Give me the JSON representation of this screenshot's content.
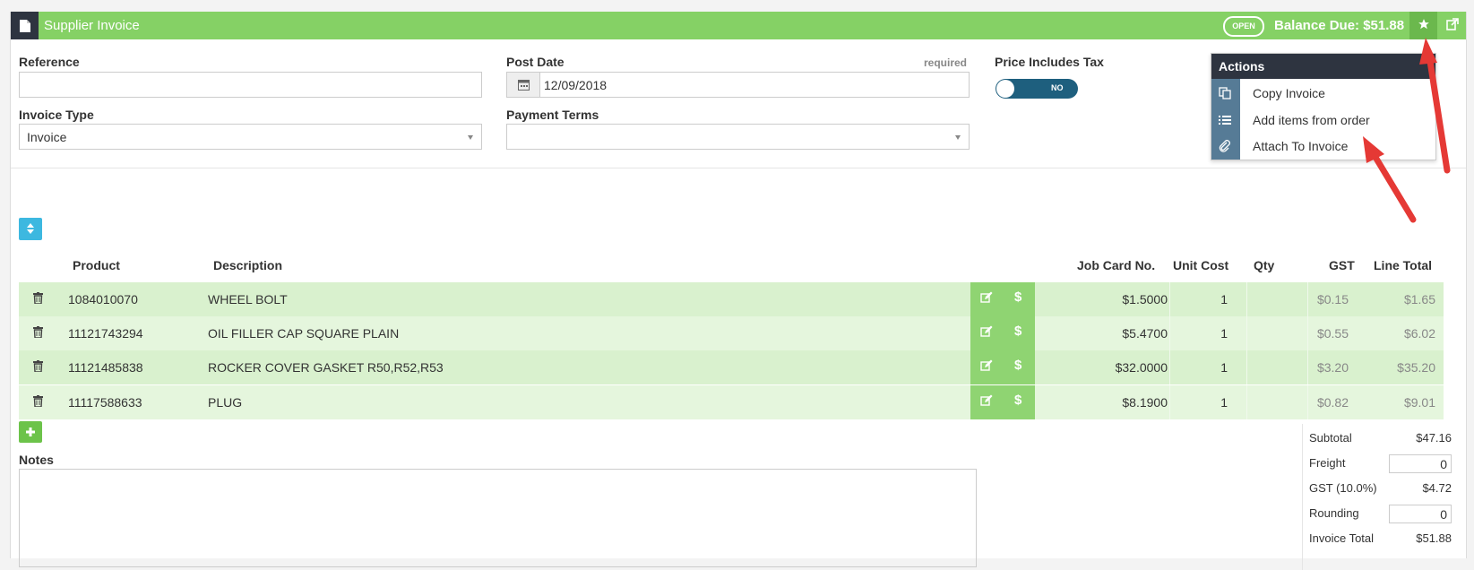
{
  "header": {
    "title": "Supplier Invoice",
    "status_badge": "OPEN",
    "balance_due": "Balance Due: $51.88"
  },
  "form": {
    "reference_label": "Reference",
    "reference_value": "",
    "post_date_label": "Post Date",
    "post_date_required": "required",
    "post_date_value": "12/09/2018",
    "price_includes_tax_label": "Price Includes Tax",
    "price_includes_tax_toggle": "NO",
    "invoice_type_label": "Invoice Type",
    "invoice_type_value": "Invoice",
    "payment_terms_label": "Payment Terms",
    "payment_terms_value": ""
  },
  "actions_menu": {
    "title": "Actions",
    "items": [
      {
        "label": "Copy Invoice",
        "icon": "copy-icon"
      },
      {
        "label": "Add items from order",
        "icon": "list-icon"
      },
      {
        "label": "Attach To Invoice",
        "icon": "paperclip-icon"
      }
    ]
  },
  "table": {
    "headers": {
      "product": "Product",
      "description": "Description",
      "job_card": "Job Card No.",
      "unit_cost": "Unit Cost",
      "qty": "Qty",
      "gst": "GST",
      "line_total": "Line Total"
    },
    "rows": [
      {
        "product": "1084010070",
        "description": "WHEEL BOLT",
        "job_card": "",
        "unit_cost": "$1.5000",
        "qty": "1",
        "gst": "$0.15",
        "line_total": "$1.65"
      },
      {
        "product": "11121743294",
        "description": "OIL FILLER CAP SQUARE PLAIN",
        "job_card": "",
        "unit_cost": "$5.4700",
        "qty": "1",
        "gst": "$0.55",
        "line_total": "$6.02"
      },
      {
        "product": "11121485838",
        "description": "ROCKER COVER GASKET R50,R52,R53",
        "job_card": "",
        "unit_cost": "$32.0000",
        "qty": "1",
        "gst": "$3.20",
        "line_total": "$35.20"
      },
      {
        "product": "11117588633",
        "description": "PLUG",
        "job_card": "",
        "unit_cost": "$8.1900",
        "qty": "1",
        "gst": "$0.82",
        "line_total": "$9.01"
      }
    ]
  },
  "notes": {
    "label": "Notes",
    "value": ""
  },
  "totals": {
    "subtotal_label": "Subtotal",
    "subtotal_value": "$47.16",
    "freight_label": "Freight",
    "freight_value": "0",
    "gst_label": "GST (10.0%)",
    "gst_value": "$4.72",
    "rounding_label": "Rounding",
    "rounding_value": "0",
    "invoice_total_label": "Invoice Total",
    "invoice_total_value": "$51.88"
  },
  "colors": {
    "header_bg": "#85d165",
    "row_even": "#d9f1ce",
    "row_odd": "#e5f6dd",
    "annotation_arrow": "#e53935"
  }
}
